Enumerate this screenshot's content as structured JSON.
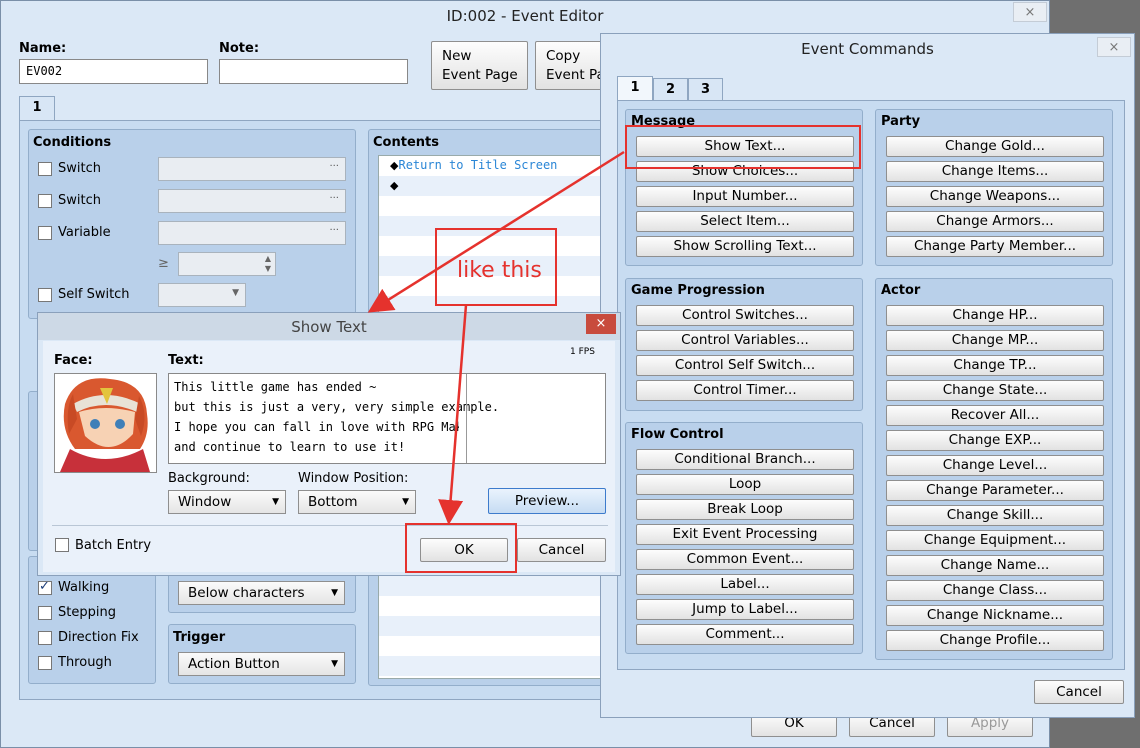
{
  "event_editor": {
    "title": "ID:002 - Event Editor",
    "close_icon": "×",
    "name_label": "Name:",
    "name_value": "EV002",
    "note_label": "Note:",
    "note_value": "",
    "new_page_line1": "New",
    "new_page_line2": "Event Page",
    "copy_page_line1": "Copy",
    "copy_page_line2": "Event Pa",
    "page_tab": "1",
    "conditions": {
      "title": "Conditions",
      "switch1": "Switch",
      "switch2": "Switch",
      "variable": "Variable",
      "self_switch": "Self Switch",
      "ellipsis": "···",
      "ge": "≥"
    },
    "contents": {
      "title": "Contents",
      "line1": "Return to Title Screen",
      "bullet": "◆"
    },
    "options": {
      "walking": "Walking",
      "stepping": "Stepping",
      "direction_fix": "Direction Fix",
      "through": "Through"
    },
    "priority_value": "Below characters",
    "trigger": {
      "title": "Trigger",
      "value": "Action Button"
    },
    "bottom_buttons": [
      "OK",
      "Cancel",
      "Apply"
    ]
  },
  "event_commands": {
    "title": "Event Commands",
    "close_icon": "×",
    "tabs": [
      "1",
      "2",
      "3"
    ],
    "message": {
      "title": "Message",
      "items": [
        "Show Text...",
        "Show Choices...",
        "Input Number...",
        "Select Item...",
        "Show Scrolling Text..."
      ]
    },
    "party": {
      "title": "Party",
      "items": [
        "Change Gold...",
        "Change Items...",
        "Change Weapons...",
        "Change Armors...",
        "Change Party Member..."
      ]
    },
    "game_progression": {
      "title": "Game Progression",
      "items": [
        "Control Switches...",
        "Control Variables...",
        "Control Self Switch...",
        "Control Timer..."
      ]
    },
    "actor": {
      "title": "Actor",
      "items": [
        "Change HP...",
        "Change MP...",
        "Change TP...",
        "Change State...",
        "Recover All...",
        "Change EXP...",
        "Change Level...",
        "Change Parameter...",
        "Change Skill...",
        "Change Equipment...",
        "Change Name...",
        "Change Class...",
        "Change Nickname...",
        "Change Profile..."
      ]
    },
    "flow_control": {
      "title": "Flow Control",
      "items": [
        "Conditional Branch...",
        "Loop",
        "Break Loop",
        "Exit Event Processing",
        "Common Event...",
        "Label...",
        "Jump to Label...",
        "Comment..."
      ]
    },
    "cancel": "Cancel"
  },
  "show_text": {
    "title": "Show Text",
    "close_icon": "×",
    "fps": "1 FPS",
    "face_label": "Face:",
    "text_label": "Text:",
    "text_lines": [
      "This little game has ended ~",
      "but this is just a very, very simple example.",
      "I hope you can fall in love with RPG Maker",
      "and continue to learn to use it!"
    ],
    "background_label": "Background:",
    "background_value": "Window",
    "window_position_label": "Window Position:",
    "window_position_value": "Bottom",
    "preview": "Preview...",
    "batch_entry": "Batch Entry",
    "ok": "OK",
    "cancel": "Cancel"
  },
  "annotation": {
    "text": "like this",
    "color": "#e5322d"
  }
}
